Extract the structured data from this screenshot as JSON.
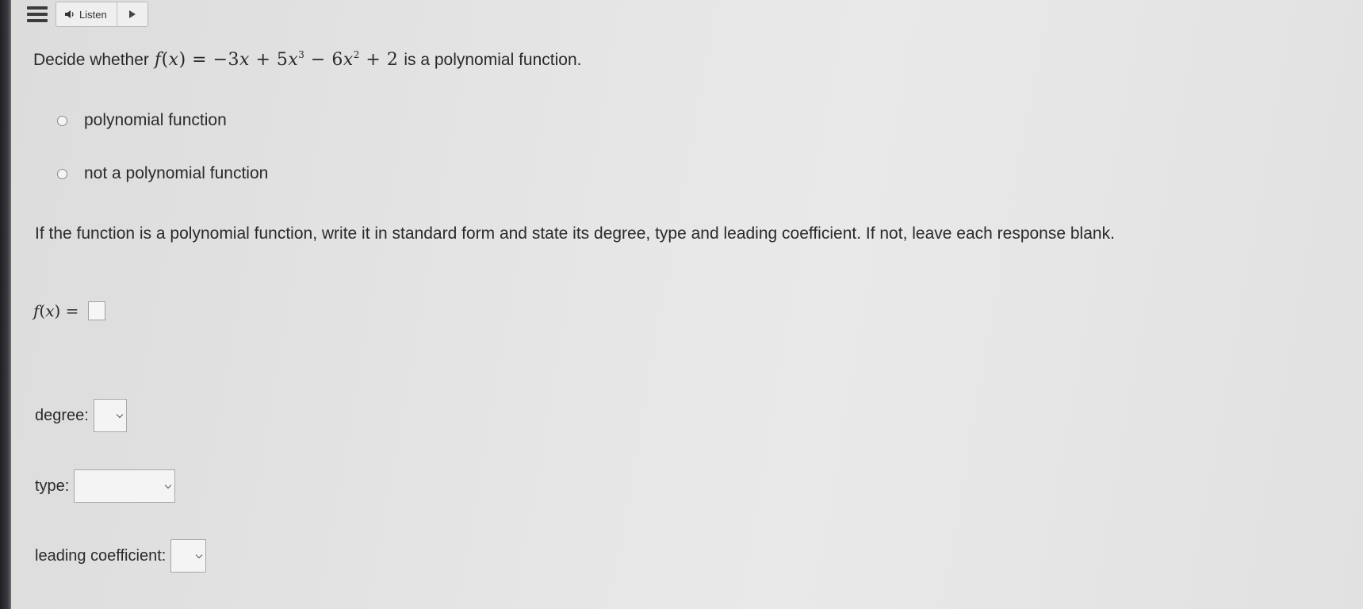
{
  "toolbar": {
    "listen_label": "Listen",
    "menu_icon": "hamburger-menu-icon",
    "speaker_icon": "speaker-icon",
    "play_icon": "play-icon"
  },
  "question": {
    "prefix": "Decide whether",
    "suffix": "is a polynomial function."
  },
  "options": [
    {
      "label": "polynomial function",
      "selected": false
    },
    {
      "label": "not a polynomial function",
      "selected": false
    }
  ],
  "instructions": "If the function is a polynomial function, write it in standard form and state its degree, type and leading coefficient. If not, leave each response blank.",
  "answers": {
    "degree_label": "degree:",
    "degree_value": "",
    "type_label": "type:",
    "type_value": "",
    "leading_label": "leading coefficient:",
    "leading_value": ""
  }
}
